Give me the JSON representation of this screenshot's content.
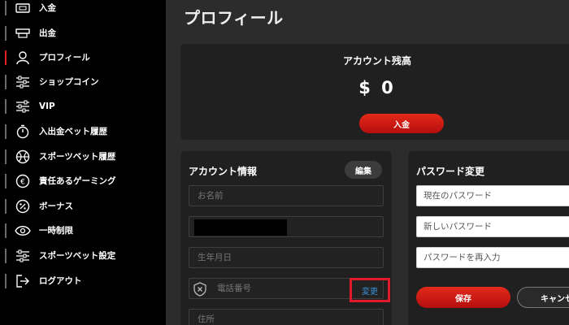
{
  "sidebar": {
    "items": [
      {
        "label": "入金",
        "icon": "deposit-icon"
      },
      {
        "label": "出金",
        "icon": "withdraw-icon"
      },
      {
        "label": "プロフィール",
        "icon": "user-icon"
      },
      {
        "label": "ショップコイン",
        "icon": "sliders-icon"
      },
      {
        "label": "VIP",
        "icon": "sliders-icon"
      },
      {
        "label": "入出金ベット履歴",
        "icon": "timer-icon"
      },
      {
        "label": "スポーツベット履歴",
        "icon": "ball-icon"
      },
      {
        "label": "責任あるゲーミング",
        "icon": "responsible-icon"
      },
      {
        "label": "ボーナス",
        "icon": "percent-icon"
      },
      {
        "label": "一時制限",
        "icon": "eye-icon"
      },
      {
        "label": "スポーツベット設定",
        "icon": "sliders-icon"
      },
      {
        "label": "ログアウト",
        "icon": "logout-icon"
      }
    ],
    "active_index": 2
  },
  "main": {
    "title": "プロフィール",
    "balance": {
      "label": "アカウント残高",
      "value": "$ 0",
      "deposit_label": "入金"
    },
    "account": {
      "title": "アカウント情報",
      "edit_label": "編集",
      "name_placeholder": "お名前",
      "birth_placeholder": "生年月日",
      "phone_placeholder": "電話番号",
      "change_label": "変更",
      "address_placeholder": "住所"
    },
    "password": {
      "title": "パスワード変更",
      "current_placeholder": "現在のパスワード",
      "new_placeholder": "新しいパスワード",
      "confirm_placeholder": "パスワードを再入力",
      "save_label": "保存",
      "cancel_label": "キャンセル"
    }
  },
  "colors": {
    "accent_red": "#e02020",
    "link_blue": "#3a8fd8"
  }
}
